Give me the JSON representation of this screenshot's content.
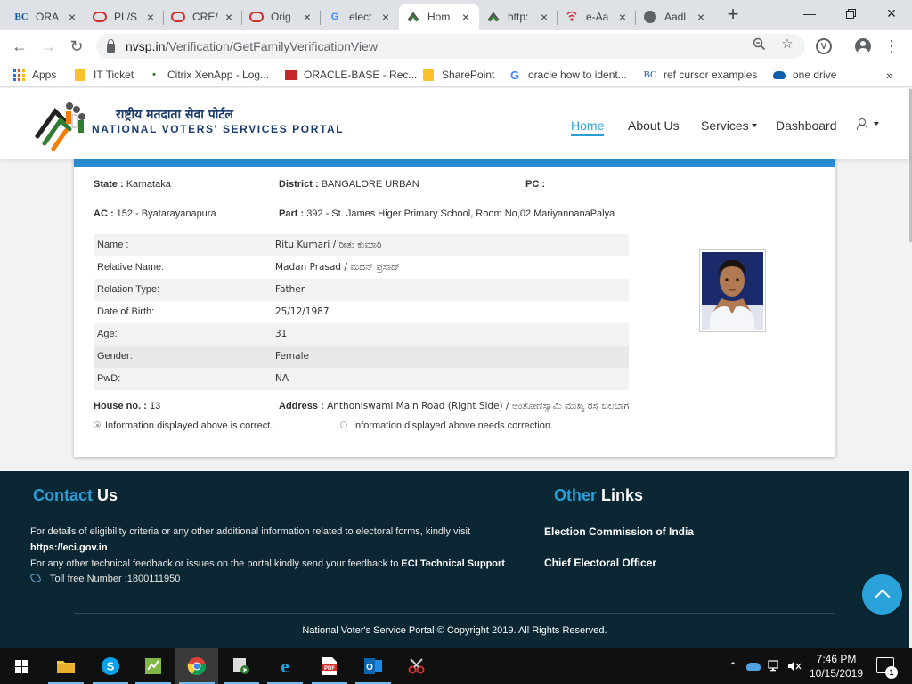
{
  "browser": {
    "tabs": [
      {
        "title": "ORA",
        "icon": "bc-icon"
      },
      {
        "title": "PL/S",
        "icon": "oracle-icon"
      },
      {
        "title": "CRE/",
        "icon": "oracle-icon"
      },
      {
        "title": "Orig",
        "icon": "oracle-icon"
      },
      {
        "title": "elect",
        "icon": "google-icon"
      },
      {
        "title": "Hom",
        "icon": "eci-logo-icon"
      },
      {
        "title": "http:",
        "icon": "eci-logo-icon"
      },
      {
        "title": "e-Aa",
        "icon": "eci-signal-icon"
      },
      {
        "title": "Aadl",
        "icon": "globe-icon"
      }
    ],
    "new_tab": "+",
    "address": {
      "host": "nvsp.in",
      "path": "/Verification/GetFamilyVerificationView"
    },
    "bookmarks": [
      {
        "label": "Apps",
        "icon": "apps-grid-icon"
      },
      {
        "label": "IT Ticket",
        "icon": "folder-icon"
      },
      {
        "label": "Citrix XenApp - Log...",
        "icon": "citrix-icon"
      },
      {
        "label": "ORACLE-BASE - Rec...",
        "icon": "oracle-base-icon"
      },
      {
        "label": "SharePoint",
        "icon": "folder-icon"
      },
      {
        "label": "oracle how to ident...",
        "icon": "google-icon"
      },
      {
        "label": "ref cursor examples",
        "icon": "bc-icon"
      },
      {
        "label": "one drive",
        "icon": "onedrive-icon"
      }
    ],
    "more_bookmarks": "»"
  },
  "site": {
    "brand_hindi": "राष्ट्रीय मतदाता सेवा पोर्टल",
    "brand_english": "NATIONAL VOTERS' SERVICES PORTAL",
    "nav": {
      "home": "Home",
      "about": "About Us",
      "services": "Services",
      "dashboard": "Dashboard"
    }
  },
  "voter": {
    "state_label": "State :",
    "state": "Karnataka",
    "district_label": "District :",
    "district": "BANGALORE URBAN",
    "pc_label": "PC :",
    "pc": "",
    "ac_label": "AC :",
    "ac": "152 - Byatarayanapura",
    "part_label": "Part :",
    "part": "392 - St. James Higer Primary School, Room No,02 MariyannanaPalya",
    "details": [
      {
        "label": "Name :",
        "value": "Ritu Kumari  / ರೀತು ಕುಮಾರಿ"
      },
      {
        "label": "Relative Name:",
        "value": "Madan Prasad  / ಮದನ್ ಪ್ರಸಾದ್"
      },
      {
        "label": "Relation Type:",
        "value": "Father"
      },
      {
        "label": "Date of Birth:",
        "value": "25/12/1987"
      },
      {
        "label": "Age:",
        "value": "31"
      },
      {
        "label": "Gender:",
        "value": "Female"
      },
      {
        "label": "PwD:",
        "value": "NA"
      }
    ],
    "house_label": "House no. :",
    "house": "13",
    "address_label": "Address :",
    "address": "Anthoniswami Main Road (Right Side) / ಅಂತೋಣಿಸ್ವಾಮಿ ಮುಖ್ಯ ರಸ್ತೆ ಬಲಬಾಗ",
    "option_correct": "Information displayed above is correct.",
    "option_correction": "Information displayed above needs correction.",
    "selected_option": "correct"
  },
  "footer": {
    "contact_accent": "Contact",
    "contact_rest": " Us",
    "links_accent": "Other",
    "links_rest": " Links",
    "line1": "For details of eligibility criteria or any other additional information related to electoral forms, kindly visit",
    "link_eci": "https://eci.gov.in",
    "line2": "For any other technical feedback or issues on the portal kindly send your feedback to",
    "link_support": "ECI Technical Support",
    "tollfree": "Toll free Number :1800111950",
    "other_links": [
      "Election Commission of India",
      "Chief Electoral Officer"
    ],
    "copyright": "National Voter's Service Portal © Copyright 2019. All Rights Reserved."
  },
  "taskbar": {
    "apps": [
      "file-explorer-icon",
      "skype-icon",
      "sticky-notes-icon",
      "chrome-icon",
      "media-player-icon",
      "internet-explorer-icon",
      "acrobat-icon",
      "outlook-icon",
      "snipping-tool-icon"
    ],
    "time": "7:46 PM",
    "date": "10/15/2019",
    "notification_count": "1"
  },
  "colors": {
    "accent": "#2a9fd6",
    "footer_bg": "#0b2733",
    "card_bar": "#2a8dd4"
  }
}
